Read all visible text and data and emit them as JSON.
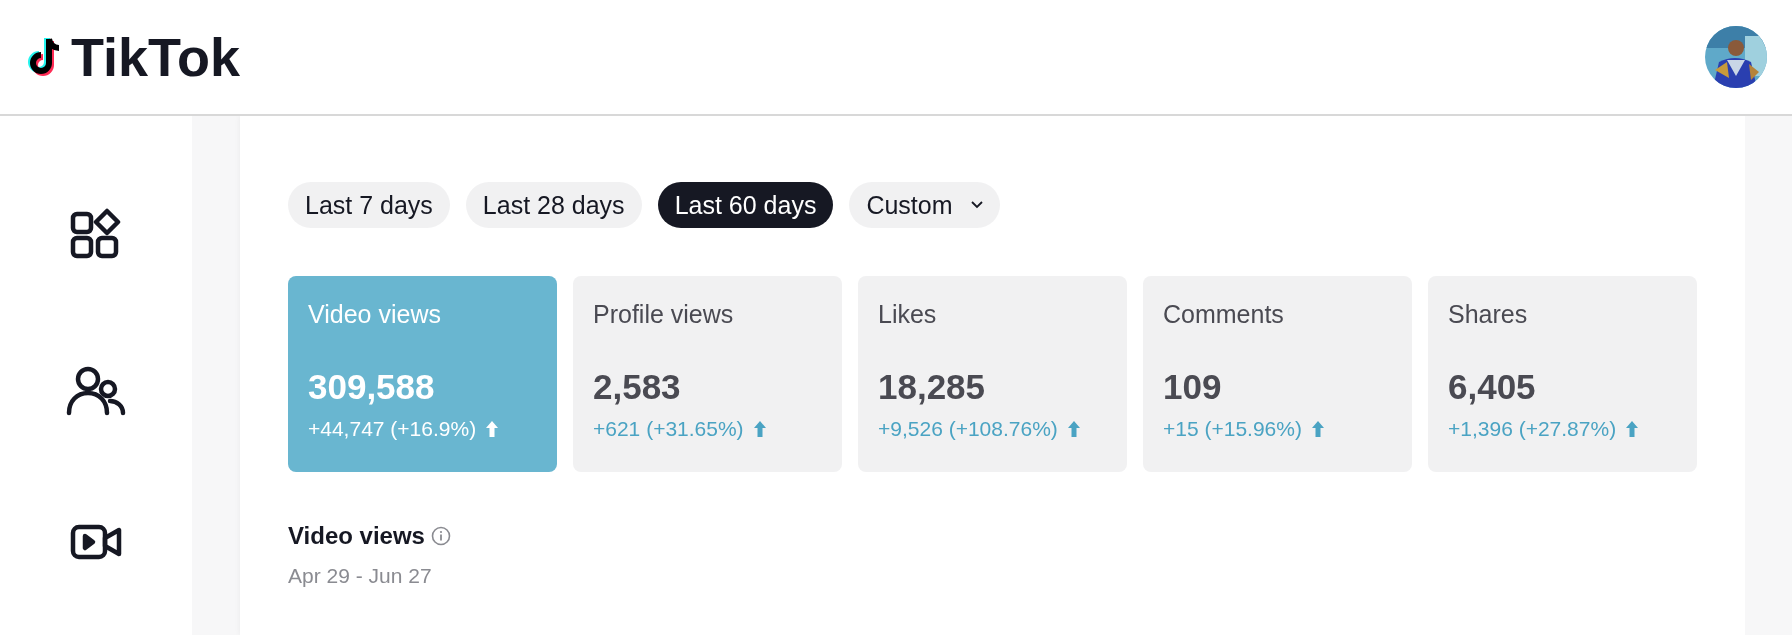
{
  "header": {
    "logo": "TikTok"
  },
  "sidebar": {
    "items": [
      {
        "kind": "dashboard"
      },
      {
        "kind": "followers"
      },
      {
        "kind": "content"
      }
    ]
  },
  "ranges": [
    {
      "label": "Last 7 days",
      "selected": false
    },
    {
      "label": "Last 28 days",
      "selected": false
    },
    {
      "label": "Last 60 days",
      "selected": true
    },
    {
      "label": "Custom",
      "selected": false,
      "kind": "dropdown"
    }
  ],
  "metrics": [
    {
      "label": "Video views",
      "value": "309,588",
      "change": "+44,747 (+16.9%)",
      "selected": true
    },
    {
      "label": "Profile views",
      "value": "2,583",
      "change": "+621 (+31.65%)",
      "selected": false
    },
    {
      "label": "Likes",
      "value": "18,285",
      "change": "+9,526 (+108.76%)",
      "selected": false
    },
    {
      "label": "Comments",
      "value": "109",
      "change": "+15 (+15.96%)",
      "selected": false
    },
    {
      "label": "Shares",
      "value": "6,405",
      "change": "+1,396 (+27.87%)",
      "selected": false
    }
  ],
  "chart_section": {
    "title": "Video views",
    "date_range": "Apr 29 - Jun 27"
  }
}
